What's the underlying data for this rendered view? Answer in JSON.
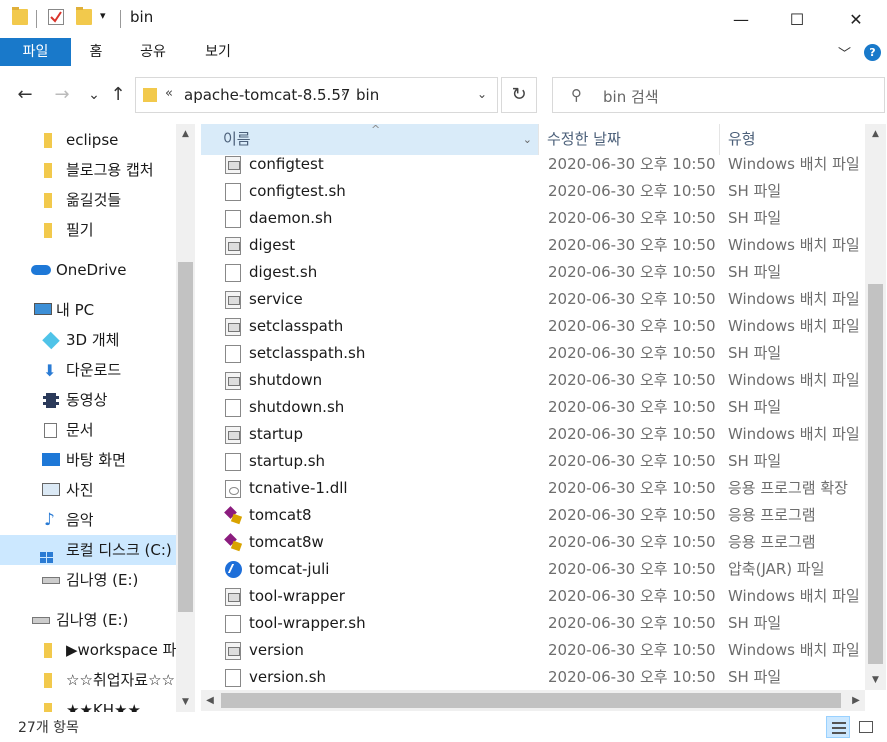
{
  "window": {
    "title": "bin",
    "minimize": "—",
    "maximize": "☐",
    "close": "✕"
  },
  "ribbon": {
    "tabs": [
      "파일",
      "홈",
      "공유",
      "보기"
    ],
    "collapse_icon": "﹀",
    "help_label": "?"
  },
  "nav": {
    "back": "←",
    "forward": "→",
    "recent": "⌄",
    "up": "↑"
  },
  "address": {
    "overflow": "«",
    "path": [
      "apache-tomcat-8.5.57",
      "bin"
    ],
    "separator": "›",
    "dropdown": "⌄",
    "refresh": "↻"
  },
  "search": {
    "placeholder": "bin 검색",
    "icon": "⚲"
  },
  "sidebar": {
    "items": [
      {
        "label": "eclipse",
        "icon": "folder-icon"
      },
      {
        "label": "블로그용 캡처",
        "icon": "folder-icon"
      },
      {
        "label": "옮길것들",
        "icon": "folder-icon"
      },
      {
        "label": "필기",
        "icon": "folder-icon"
      },
      {
        "label": "OneDrive",
        "icon": "cloud-icon"
      },
      {
        "label": "내 PC",
        "icon": "computer-icon"
      },
      {
        "label": "3D 개체",
        "icon": "cube-icon"
      },
      {
        "label": "다운로드",
        "icon": "download-icon"
      },
      {
        "label": "동영상",
        "icon": "film-icon"
      },
      {
        "label": "문서",
        "icon": "document-icon"
      },
      {
        "label": "바탕 화면",
        "icon": "desktop-icon"
      },
      {
        "label": "사진",
        "icon": "picture-icon"
      },
      {
        "label": "음악",
        "icon": "music-icon"
      },
      {
        "label": "로컬 디스크 (C:)",
        "icon": "drive-icon"
      },
      {
        "label": "김나영 (E:)",
        "icon": "usb-drive-icon"
      },
      {
        "label": "김나영 (E:)",
        "icon": "usb-drive-icon"
      },
      {
        "label": "▶workspace 파일",
        "icon": "folder-icon"
      },
      {
        "label": "☆☆취업자료☆☆",
        "icon": "folder-icon"
      },
      {
        "label": "★★KH★★",
        "icon": "folder-icon"
      }
    ]
  },
  "columns": {
    "name": "이름",
    "date": "수정한 날짜",
    "type": "유형"
  },
  "files": [
    {
      "name": "configtest",
      "date": "2020-06-30 오후 10:50",
      "type": "Windows 배치 파일",
      "icon": "bat"
    },
    {
      "name": "configtest.sh",
      "date": "2020-06-30 오후 10:50",
      "type": "SH 파일",
      "icon": "doc"
    },
    {
      "name": "daemon.sh",
      "date": "2020-06-30 오후 10:50",
      "type": "SH 파일",
      "icon": "doc"
    },
    {
      "name": "digest",
      "date": "2020-06-30 오후 10:50",
      "type": "Windows 배치 파일",
      "icon": "bat"
    },
    {
      "name": "digest.sh",
      "date": "2020-06-30 오후 10:50",
      "type": "SH 파일",
      "icon": "doc"
    },
    {
      "name": "service",
      "date": "2020-06-30 오후 10:50",
      "type": "Windows 배치 파일",
      "icon": "bat"
    },
    {
      "name": "setclasspath",
      "date": "2020-06-30 오후 10:50",
      "type": "Windows 배치 파일",
      "icon": "bat"
    },
    {
      "name": "setclasspath.sh",
      "date": "2020-06-30 오후 10:50",
      "type": "SH 파일",
      "icon": "doc"
    },
    {
      "name": "shutdown",
      "date": "2020-06-30 오후 10:50",
      "type": "Windows 배치 파일",
      "icon": "bat"
    },
    {
      "name": "shutdown.sh",
      "date": "2020-06-30 오후 10:50",
      "type": "SH 파일",
      "icon": "doc"
    },
    {
      "name": "startup",
      "date": "2020-06-30 오후 10:50",
      "type": "Windows 배치 파일",
      "icon": "bat"
    },
    {
      "name": "startup.sh",
      "date": "2020-06-30 오후 10:50",
      "type": "SH 파일",
      "icon": "doc"
    },
    {
      "name": "tcnative-1.dll",
      "date": "2020-06-30 오후 10:50",
      "type": "응용 프로그램 확장",
      "icon": "dll"
    },
    {
      "name": "tomcat8",
      "date": "2020-06-30 오후 10:50",
      "type": "응용 프로그램",
      "icon": "exe"
    },
    {
      "name": "tomcat8w",
      "date": "2020-06-30 오후 10:50",
      "type": "응용 프로그램",
      "icon": "exe"
    },
    {
      "name": "tomcat-juli",
      "date": "2020-06-30 오후 10:50",
      "type": "압축(JAR) 파일",
      "icon": "jar"
    },
    {
      "name": "tool-wrapper",
      "date": "2020-06-30 오후 10:50",
      "type": "Windows 배치 파일",
      "icon": "bat"
    },
    {
      "name": "tool-wrapper.sh",
      "date": "2020-06-30 오후 10:50",
      "type": "SH 파일",
      "icon": "doc"
    },
    {
      "name": "version",
      "date": "2020-06-30 오후 10:50",
      "type": "Windows 배치 파일",
      "icon": "bat"
    },
    {
      "name": "version.sh",
      "date": "2020-06-30 오후 10:50",
      "type": "SH 파일",
      "icon": "doc"
    }
  ],
  "status": {
    "count": "27개 항목"
  },
  "colors": {
    "accent": "#1979ca",
    "selection": "#cce8ff"
  }
}
